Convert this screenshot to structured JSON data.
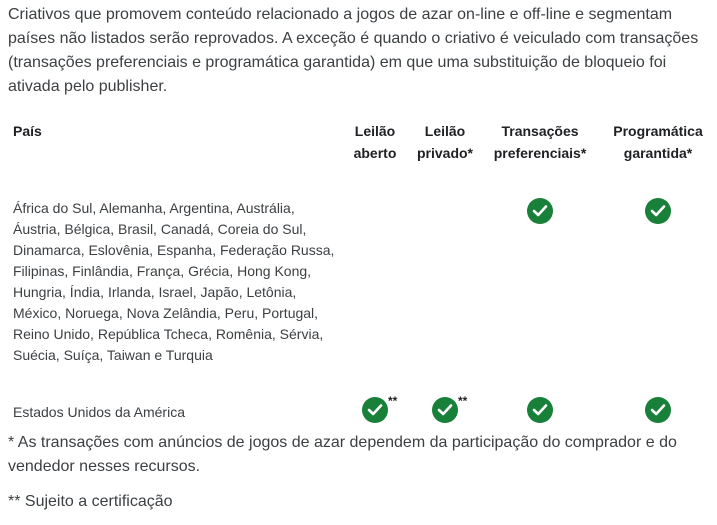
{
  "intro": "Criativos que promovem conteúdo relacionado a jogos de azar on-line e off-line e segmentam países não listados serão reprovados. A exceção é quando o criativo é veiculado com transações (transações preferenciais e programática garantida) em que uma substituição de bloqueio foi ativada pelo publisher.",
  "table": {
    "headers": {
      "country": "País",
      "open_auction": "Leilão aberto",
      "private_auction": "Leilão privado*",
      "preferred_deals": "Transações preferenciais*",
      "programmatic_guaranteed": "Programática garantida*"
    },
    "rows": [
      {
        "countries": "África do Sul, Alemanha, Argentina, Austrália, Áustria, Bélgica, Brasil, Canadá, Coreia do Sul, Dinamarca, Eslovênia, Espanha, Federação Russa, Filipinas, Finlândia, França, Grécia, Hong Kong, Hungria, Índia, Irlanda, Israel, Japão, Letônia, México, Noruega, Nova Zelândia, Peru, Portugal, Reino Unido, República Tcheca, Romênia, Sérvia, Suécia, Suíça, Taiwan e Turquia",
        "open_auction": false,
        "private_auction": false,
        "preferred_deals": true,
        "programmatic_guaranteed": true,
        "open_auction_note": "",
        "private_auction_note": ""
      },
      {
        "countries": "Estados Unidos da América",
        "open_auction": true,
        "private_auction": true,
        "preferred_deals": true,
        "programmatic_guaranteed": true,
        "open_auction_note": "**",
        "private_auction_note": "**"
      }
    ]
  },
  "footnotes": {
    "single": "* As transações com anúncios de jogos de azar dependem da participação do comprador e do vendedor nesses recursos.",
    "double": "** Sujeito a certificação"
  },
  "colors": {
    "check": "#188038",
    "text": "#3c4043"
  },
  "icons": {
    "allowed": "check-circle-icon"
  }
}
